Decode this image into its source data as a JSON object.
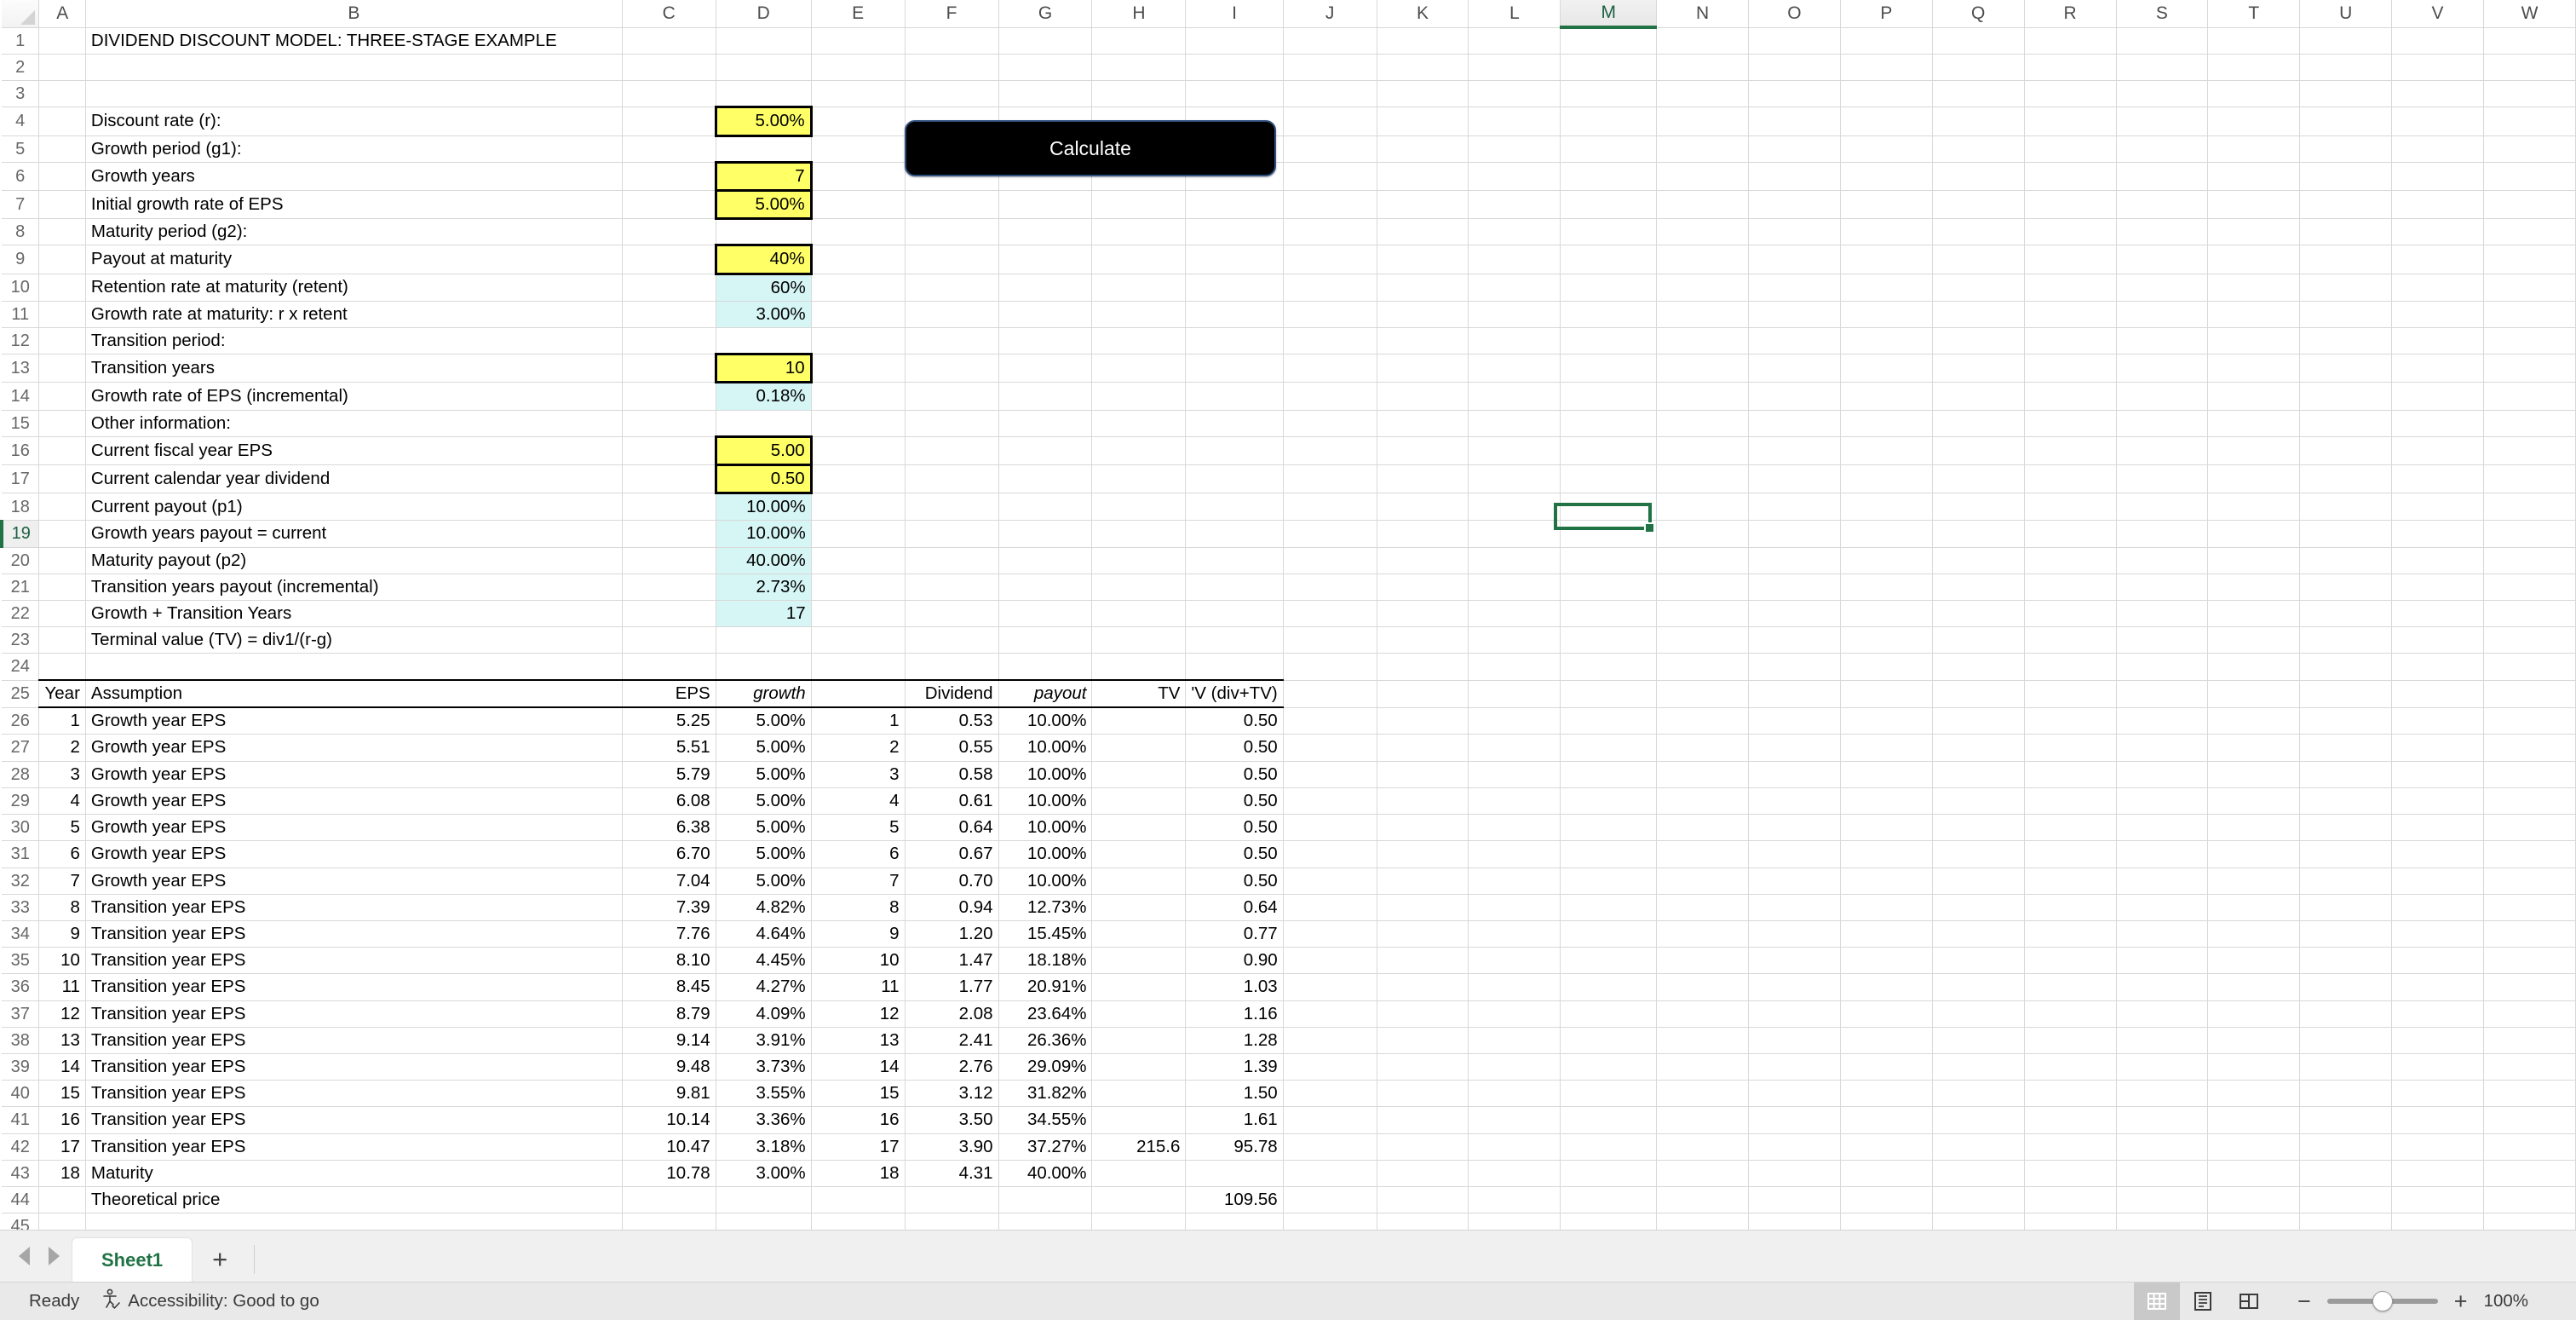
{
  "app": {
    "name": "Excel Spreadsheet"
  },
  "columns": [
    "A",
    "B",
    "C",
    "D",
    "E",
    "F",
    "G",
    "H",
    "I",
    "J",
    "K",
    "L",
    "M",
    "N",
    "O",
    "P",
    "Q",
    "R",
    "S",
    "T",
    "U",
    "V",
    "W"
  ],
  "selected_column": "M",
  "selected_row": 19,
  "active_cell": "M19",
  "calculate_button": {
    "label": "Calculate"
  },
  "title": "DIVIDEND DISCOUNT MODEL: THREE-STAGE EXAMPLE",
  "assumptions": [
    {
      "row": 4,
      "label": "Discount rate (r):",
      "value": "5.00%",
      "style": "input",
      "bold": true
    },
    {
      "row": 5,
      "label": "Growth period (g1):",
      "value": "",
      "style": "none",
      "bold": true
    },
    {
      "row": 6,
      "label": "Growth years",
      "value": "7",
      "style": "input",
      "bold": false
    },
    {
      "row": 7,
      "label": "Initial growth rate of EPS",
      "value": "5.00%",
      "style": "input",
      "bold": false
    },
    {
      "row": 8,
      "label": "Maturity period (g2):",
      "value": "",
      "style": "none",
      "bold": true
    },
    {
      "row": 9,
      "label": "Payout at maturity",
      "value": "40%",
      "style": "input",
      "bold": false
    },
    {
      "row": 10,
      "label": "Retention rate at maturity (retent)",
      "value": "60%",
      "style": "calc",
      "bold": false
    },
    {
      "row": 11,
      "label": "Growth rate at maturity: r x retent",
      "value": "3.00%",
      "style": "calc",
      "bold": false
    },
    {
      "row": 12,
      "label": "Transition period:",
      "value": "",
      "style": "none",
      "bold": true
    },
    {
      "row": 13,
      "label": "Transition years",
      "value": "10",
      "style": "input",
      "bold": false
    },
    {
      "row": 14,
      "label": "Growth rate of EPS (incremental)",
      "value": "0.18%",
      "style": "calc",
      "bold": false
    },
    {
      "row": 15,
      "label": "Other information:",
      "value": "",
      "style": "none",
      "bold": true
    },
    {
      "row": 16,
      "label": "Current fiscal year EPS",
      "value": "5.00",
      "style": "input",
      "bold": false
    },
    {
      "row": 17,
      "label": "Current calendar year dividend",
      "value": "0.50",
      "style": "input",
      "bold": false
    },
    {
      "row": 18,
      "label": "Current payout (p1)",
      "value": "10.00%",
      "style": "calc",
      "bold": false
    },
    {
      "row": 19,
      "label": "Growth years payout = current",
      "value": "10.00%",
      "style": "calc",
      "bold": false
    },
    {
      "row": 20,
      "label": "Maturity payout (p2)",
      "value": "40.00%",
      "style": "calc",
      "bold": false
    },
    {
      "row": 21,
      "label": "Transition years payout (incremental)",
      "value": "2.73%",
      "style": "calc",
      "bold": false
    },
    {
      "row": 22,
      "label": "Growth + Transition Years",
      "value": "17",
      "style": "calc",
      "bold": false
    },
    {
      "row": 23,
      "label": "Terminal value (TV) = div1/(r-g)",
      "value": "",
      "style": "none",
      "bold": false
    }
  ],
  "table": {
    "header_row": 25,
    "headers": {
      "year": "Year",
      "assumption": "Assumption",
      "eps": "EPS",
      "growth": "growth",
      "n": "",
      "dividend": "Dividend",
      "payout": "payout",
      "tv": "TV",
      "pv": "'V (div+TV)"
    },
    "rows": [
      {
        "row": 26,
        "year": "1",
        "assumption": "Growth year EPS",
        "eps": "5.25",
        "growth": "5.00%",
        "n": "1",
        "dividend": "0.53",
        "payout": "10.00%",
        "tv": "",
        "pv": "0.50"
      },
      {
        "row": 27,
        "year": "2",
        "assumption": "Growth year EPS",
        "eps": "5.51",
        "growth": "5.00%",
        "n": "2",
        "dividend": "0.55",
        "payout": "10.00%",
        "tv": "",
        "pv": "0.50"
      },
      {
        "row": 28,
        "year": "3",
        "assumption": "Growth year EPS",
        "eps": "5.79",
        "growth": "5.00%",
        "n": "3",
        "dividend": "0.58",
        "payout": "10.00%",
        "tv": "",
        "pv": "0.50"
      },
      {
        "row": 29,
        "year": "4",
        "assumption": "Growth year EPS",
        "eps": "6.08",
        "growth": "5.00%",
        "n": "4",
        "dividend": "0.61",
        "payout": "10.00%",
        "tv": "",
        "pv": "0.50"
      },
      {
        "row": 30,
        "year": "5",
        "assumption": "Growth year EPS",
        "eps": "6.38",
        "growth": "5.00%",
        "n": "5",
        "dividend": "0.64",
        "payout": "10.00%",
        "tv": "",
        "pv": "0.50"
      },
      {
        "row": 31,
        "year": "6",
        "assumption": "Growth year EPS",
        "eps": "6.70",
        "growth": "5.00%",
        "n": "6",
        "dividend": "0.67",
        "payout": "10.00%",
        "tv": "",
        "pv": "0.50"
      },
      {
        "row": 32,
        "year": "7",
        "assumption": "Growth year EPS",
        "eps": "7.04",
        "growth": "5.00%",
        "n": "7",
        "dividend": "0.70",
        "payout": "10.00%",
        "tv": "",
        "pv": "0.50"
      },
      {
        "row": 33,
        "year": "8",
        "assumption": "Transition year EPS",
        "eps": "7.39",
        "growth": "4.82%",
        "n": "8",
        "dividend": "0.94",
        "payout": "12.73%",
        "tv": "",
        "pv": "0.64"
      },
      {
        "row": 34,
        "year": "9",
        "assumption": "Transition year EPS",
        "eps": "7.76",
        "growth": "4.64%",
        "n": "9",
        "dividend": "1.20",
        "payout": "15.45%",
        "tv": "",
        "pv": "0.77"
      },
      {
        "row": 35,
        "year": "10",
        "assumption": "Transition year EPS",
        "eps": "8.10",
        "growth": "4.45%",
        "n": "10",
        "dividend": "1.47",
        "payout": "18.18%",
        "tv": "",
        "pv": "0.90"
      },
      {
        "row": 36,
        "year": "11",
        "assumption": "Transition year EPS",
        "eps": "8.45",
        "growth": "4.27%",
        "n": "11",
        "dividend": "1.77",
        "payout": "20.91%",
        "tv": "",
        "pv": "1.03"
      },
      {
        "row": 37,
        "year": "12",
        "assumption": "Transition year EPS",
        "eps": "8.79",
        "growth": "4.09%",
        "n": "12",
        "dividend": "2.08",
        "payout": "23.64%",
        "tv": "",
        "pv": "1.16"
      },
      {
        "row": 38,
        "year": "13",
        "assumption": "Transition year EPS",
        "eps": "9.14",
        "growth": "3.91%",
        "n": "13",
        "dividend": "2.41",
        "payout": "26.36%",
        "tv": "",
        "pv": "1.28"
      },
      {
        "row": 39,
        "year": "14",
        "assumption": "Transition year EPS",
        "eps": "9.48",
        "growth": "3.73%",
        "n": "14",
        "dividend": "2.76",
        "payout": "29.09%",
        "tv": "",
        "pv": "1.39"
      },
      {
        "row": 40,
        "year": "15",
        "assumption": "Transition year EPS",
        "eps": "9.81",
        "growth": "3.55%",
        "n": "15",
        "dividend": "3.12",
        "payout": "31.82%",
        "tv": "",
        "pv": "1.50"
      },
      {
        "row": 41,
        "year": "16",
        "assumption": "Transition year EPS",
        "eps": "10.14",
        "growth": "3.36%",
        "n": "16",
        "dividend": "3.50",
        "payout": "34.55%",
        "tv": "",
        "pv": "1.61"
      },
      {
        "row": 42,
        "year": "17",
        "assumption": "Transition year EPS",
        "eps": "10.47",
        "growth": "3.18%",
        "n": "17",
        "dividend": "3.90",
        "payout": "37.27%",
        "tv": "215.6",
        "pv": "95.78"
      },
      {
        "row": 43,
        "year": "18",
        "assumption": "Maturity",
        "eps": "10.78",
        "growth": "3.00%",
        "n": "18",
        "dividend": "4.31",
        "payout": "40.00%",
        "tv": "",
        "pv": ""
      }
    ],
    "total": {
      "row": 44,
      "label": "Theoretical price",
      "value": "109.56"
    }
  },
  "tabs": {
    "sheet_name": "Sheet1",
    "add_label": "+"
  },
  "statusbar": {
    "mode": "Ready",
    "accessibility": "Accessibility: Good to go",
    "zoom": "100%"
  },
  "colors": {
    "accent": "#217346",
    "input_fill": "#ffff66",
    "calc_fill": "#d6f5f5",
    "button_bg": "#000000"
  }
}
